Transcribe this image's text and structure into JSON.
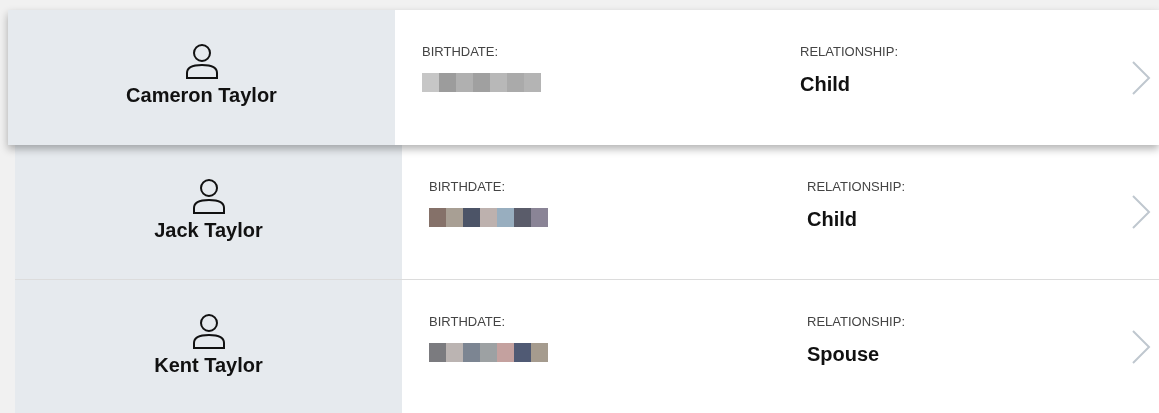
{
  "members": [
    {
      "name": "Cameron Taylor",
      "birthdate_label": "BIRTHDATE:",
      "relationship_label": "RELATIONSHIP:",
      "relationship": "Child",
      "selected": true
    },
    {
      "name": "Jack Taylor",
      "birthdate_label": "BIRTHDATE:",
      "relationship_label": "RELATIONSHIP:",
      "relationship": "Child",
      "selected": false
    },
    {
      "name": "Kent Taylor",
      "birthdate_label": "BIRTHDATE:",
      "relationship_label": "RELATIONSHIP:",
      "relationship": "Spouse",
      "selected": false
    }
  ]
}
